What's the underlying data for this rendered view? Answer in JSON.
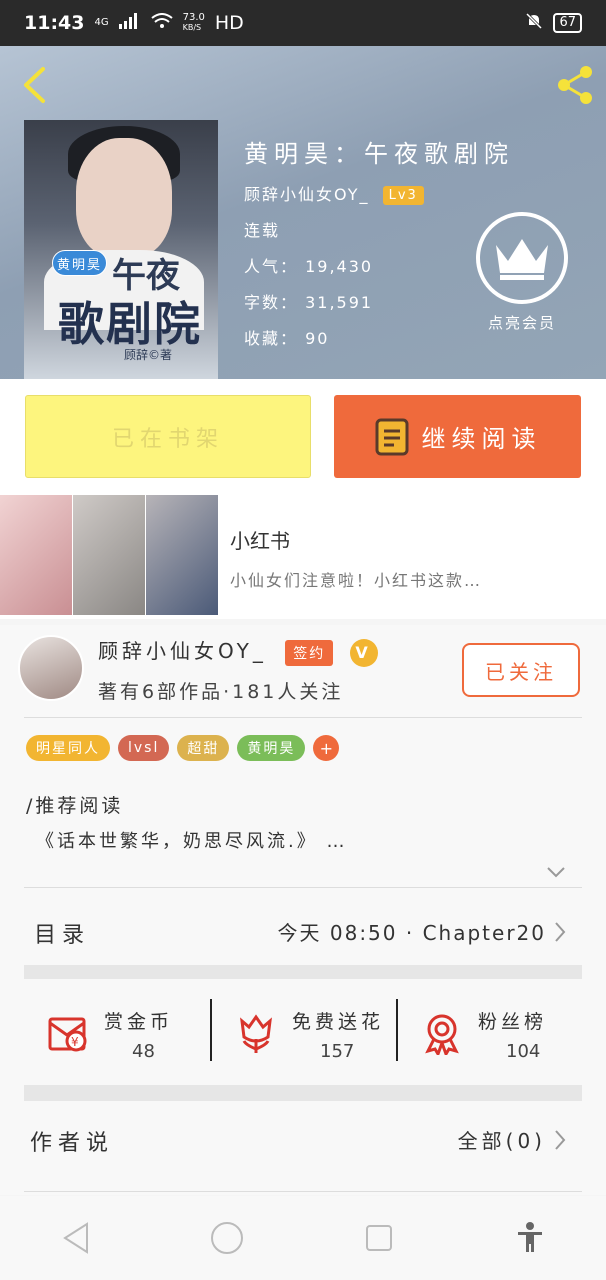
{
  "status_bar": {
    "time": "11:43",
    "network": "4G",
    "speed": "73.0",
    "speed_unit": "KB/S",
    "hd": "HD",
    "battery": "67"
  },
  "book": {
    "title": "黄明昊：午夜歌剧院",
    "author": "顾辞小仙女OY_",
    "level": "Lv3",
    "status": "连载",
    "popularity_label": "人气：",
    "popularity": "19,430",
    "words_label": "字数：",
    "words": "31,591",
    "favorites_label": "收藏：",
    "favorites": "90",
    "cover": {
      "tag": "黄明昊",
      "title_top": "午夜",
      "title_bottom": "歌剧院",
      "author": "顾辞©著"
    },
    "vip_label": "点亮会员"
  },
  "actions": {
    "shelf": "已在书架",
    "read": "继续阅读"
  },
  "ad": {
    "title": "小红书",
    "desc": "小仙女们注意啦！小红书这款…",
    "close": "✕"
  },
  "author_card": {
    "name": "顾辞小仙女OY_",
    "sign": "签约",
    "v": "V",
    "stats": "著有6部作品·181人关注",
    "follow": "已关注",
    "tags": [
      "明星同人",
      "lvsl",
      "超甜",
      "黄明昊"
    ],
    "tag_plus": "+",
    "recommend_label": "/推荐阅读",
    "recommend_text": "《话本世繁华，奶思尽风流.》 …",
    "toc_label": "目录",
    "toc_latest": "今天 08:50 · Chapter20",
    "stats_row": [
      {
        "label": "赏金币",
        "value": "48",
        "icon": "gold-coin-icon"
      },
      {
        "label": "免费送花",
        "value": "157",
        "icon": "flower-icon"
      },
      {
        "label": "粉丝榜",
        "value": "104",
        "icon": "medal-icon"
      }
    ],
    "author_say_label": "作者说",
    "author_say_all": "全部(0)"
  },
  "colors": {
    "accent": "#ef6a3c",
    "gold": "#f2b531",
    "shelf_bg": "#fdf57e"
  }
}
